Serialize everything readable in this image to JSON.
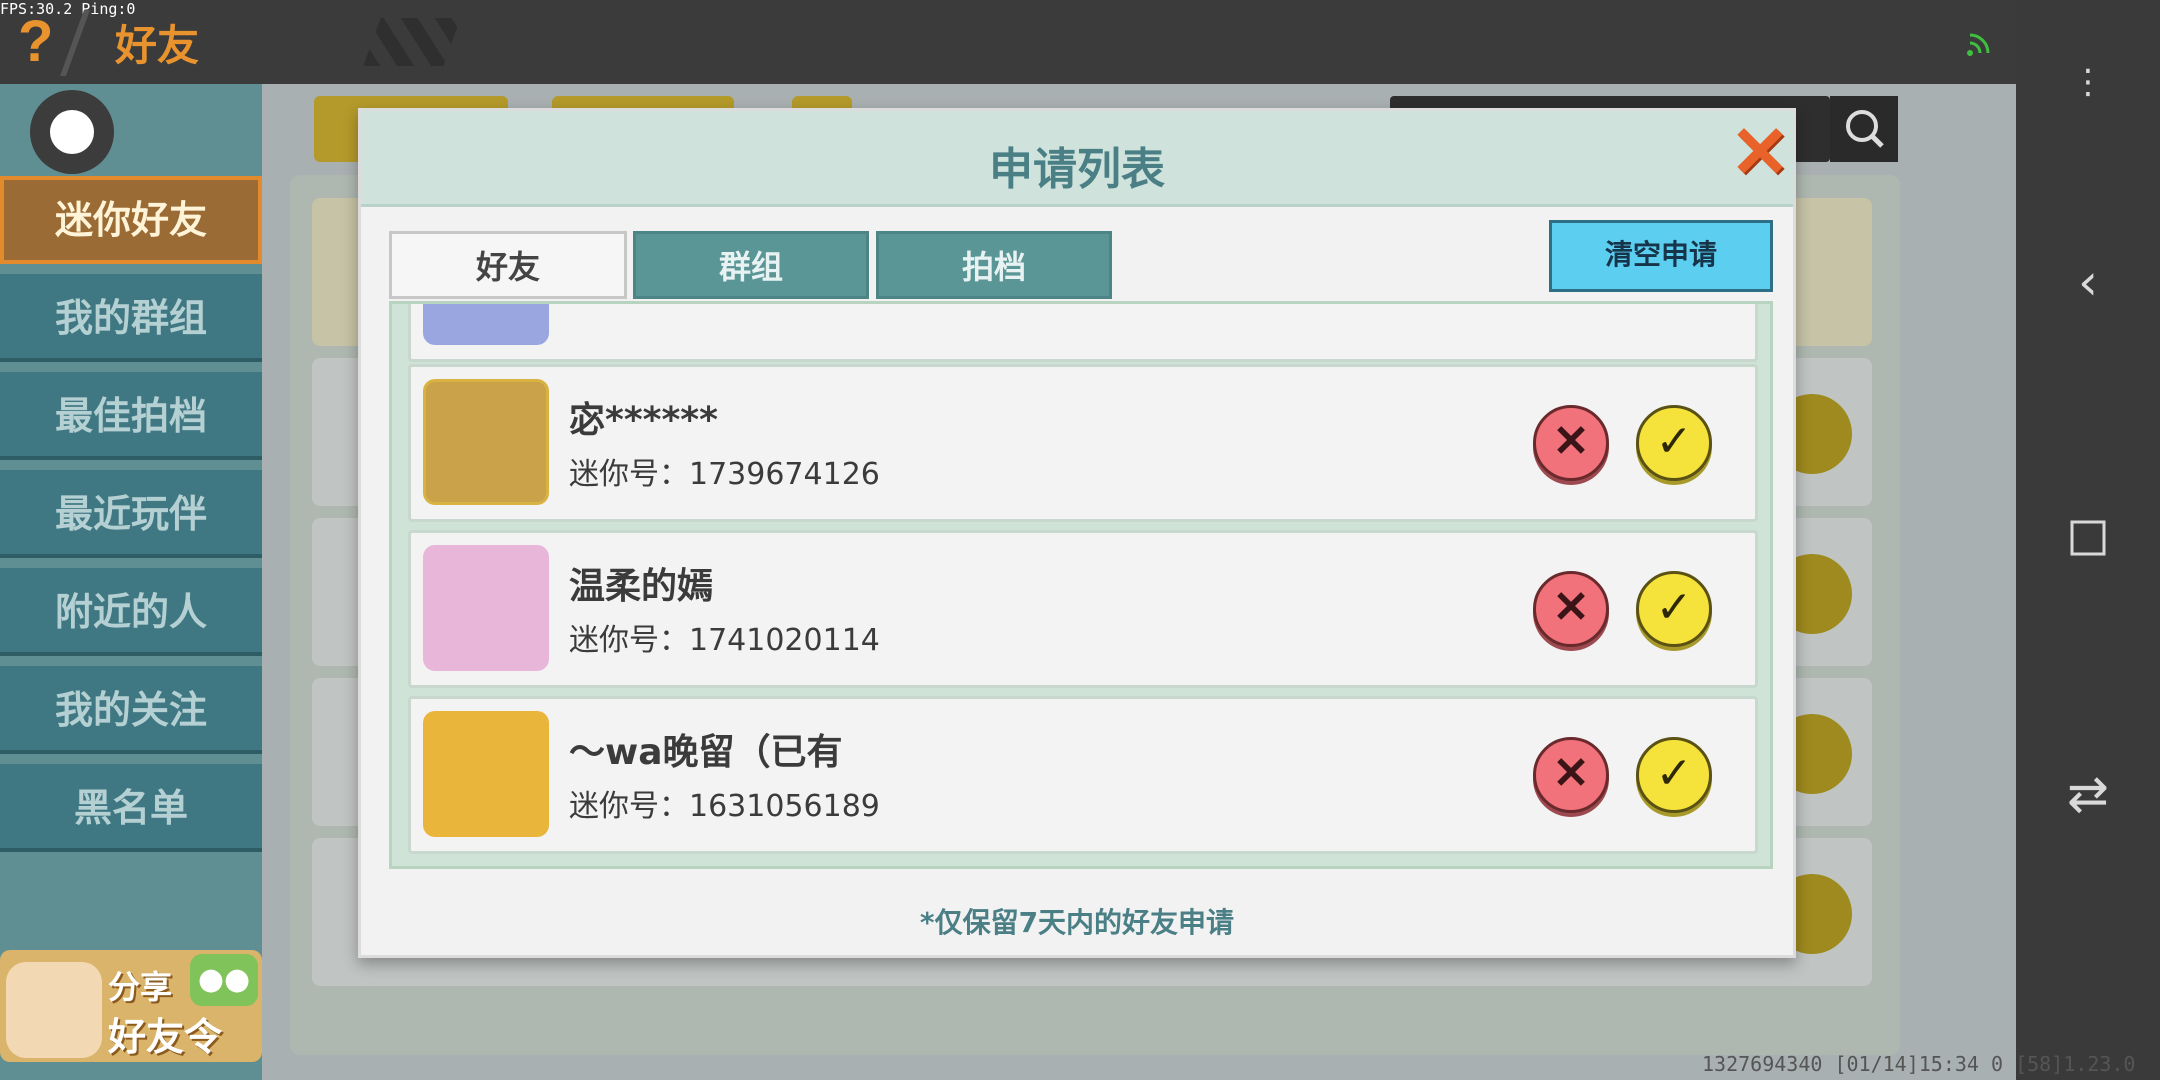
{
  "statusbar": {
    "fps": "FPS:30.2  Ping:0"
  },
  "topbar": {
    "help_glyph": "?",
    "title": "好友",
    "close_glyph": "✕"
  },
  "sidebar": {
    "items": [
      {
        "label": "迷你好友",
        "active": true
      },
      {
        "label": "我的群组"
      },
      {
        "label": "最佳拍档"
      },
      {
        "label": "最近玩伴"
      },
      {
        "label": "附近的人"
      },
      {
        "label": "我的关注"
      },
      {
        "label": "黑名单"
      }
    ],
    "share": {
      "line1": "分享",
      "line2": "好友令"
    }
  },
  "dialog": {
    "title": "申请列表",
    "close_icon": "close-icon",
    "tabs": [
      {
        "label": "好友",
        "active": true
      },
      {
        "label": "群组"
      },
      {
        "label": "拍档"
      }
    ],
    "clear_label": "清空申请",
    "requests": [
      {
        "name": "宓******",
        "id_label": "迷你号：",
        "id": "1739674126",
        "avatar_color": "#c9a24a"
      },
      {
        "name": "温柔的嫣",
        "id_label": "迷你号：",
        "id": "1741020114",
        "avatar_color": "#e7b6d8"
      },
      {
        "name": "～wa晚留（已有",
        "id_label": "迷你号：",
        "id": "1631056189",
        "avatar_color": "#e9b53a"
      }
    ],
    "note": "*仅保留7天内的好友申请"
  },
  "bottom_status": "1327694340   [01/14]15:34 0  [58]1.23.0",
  "colors": {
    "accent": "#e8932e",
    "teal": "#4a7f86",
    "accept": "#f5e23a",
    "reject": "#f1727a"
  }
}
